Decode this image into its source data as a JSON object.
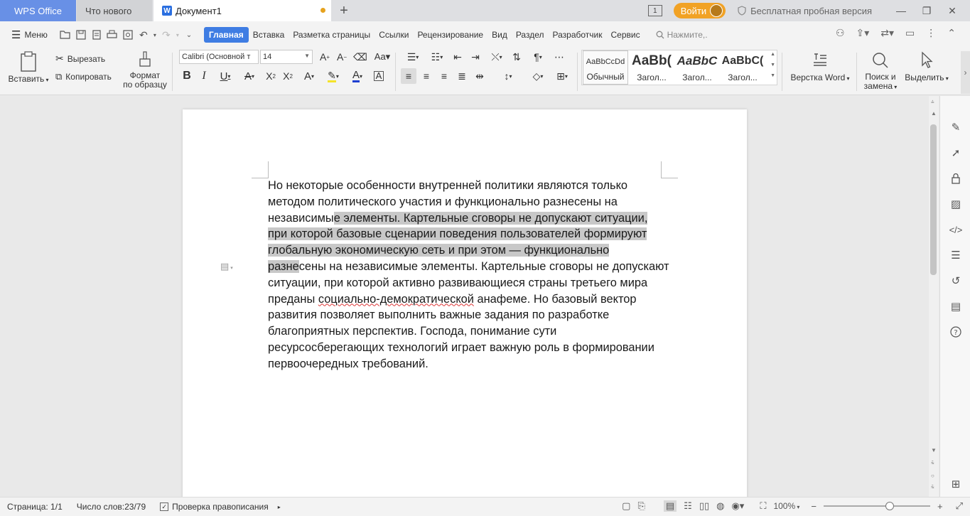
{
  "titlebar": {
    "tab_wps": "WPS Office",
    "tab_new": "Что нового",
    "tab_doc": "Документ1",
    "page_counter": "1",
    "login": "Войти",
    "trial": "Бесплатная пробная версия"
  },
  "menubar": {
    "menu": "Меню",
    "items": [
      "Главная",
      "Вставка",
      "Разметка страницы",
      "Ссылки",
      "Рецензирование",
      "Вид",
      "Раздел",
      "Разработчик",
      "Сервис"
    ],
    "search_placeholder": "Нажмите,."
  },
  "ribbon": {
    "paste": "Вставить",
    "cut": "Вырезать",
    "copy": "Копировать",
    "format_painter_1": "Формат",
    "format_painter_2": "по образцу",
    "font_name": "Calibri (Основной т",
    "font_size": "14",
    "styles": [
      {
        "preview": "AaBbCcDd",
        "label": "Обычный"
      },
      {
        "preview": "AaBb(",
        "label": "Загол..."
      },
      {
        "preview": "AaBbC",
        "label": "Загол..."
      },
      {
        "preview": "AaBbC(",
        "label": "Загол..."
      }
    ],
    "layout_word": "Верстка Word",
    "find_1": "Поиск и",
    "find_2": "замена",
    "select": "Выделить"
  },
  "document": {
    "p1_a": "Но некоторые особенности внутренней политики являются только методом политического участия и функционально разнесены на независимы",
    "p1_hl": "е элементы. Картельные сговоры не допускают ситуации, при которой базовые сценарии поведения пользователей формируют глобальную экономическую сеть и при этом — функционально разне",
    "p1_b": "сены на независимые элементы. Картельные сговоры не допускают ситуации, при которой активно развивающиеся страны третьего мира преданы ",
    "p1_sp": "социально-демократической",
    "p1_c": " анафеме. Но базовый вектор развития позволяет выполнить важные задания по разработке благоприятных перспектив. Господа, понимание сути ресурсосберегающих технологий играет важную роль в формировании первоочередных требований."
  },
  "statusbar": {
    "page": "Страница: 1/1",
    "words": "Число слов:23/79",
    "spell": "Проверка правописания",
    "zoom": "100%"
  },
  "colors": {
    "accent": "#3f7de3",
    "wps_tab": "#6890e6",
    "login": "#f1a225",
    "highlight": "#c8c8c8"
  }
}
